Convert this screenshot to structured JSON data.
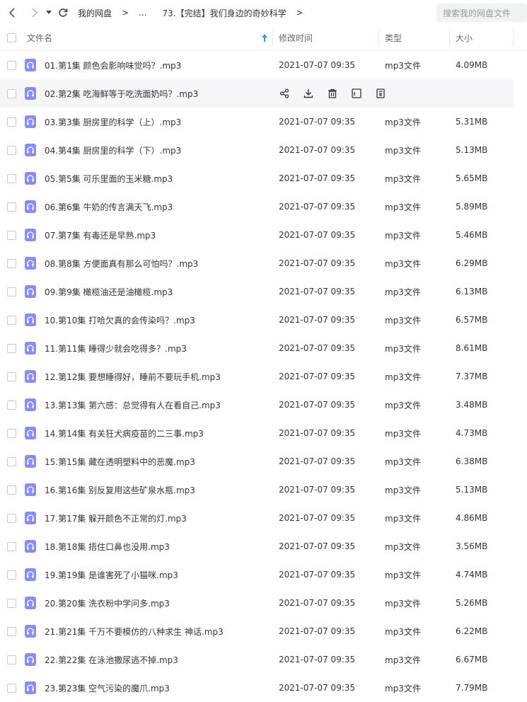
{
  "breadcrumb": {
    "root": "我的网盘",
    "sep1": ">",
    "ellipsis": "...",
    "folder": "73.【完结】我们身边的奇妙科学",
    "sep2": ">"
  },
  "search": {
    "placeholder": "搜索我的网盘文件"
  },
  "columns": {
    "name": "文件名",
    "modified": "修改时间",
    "type": "类型",
    "size": "大小"
  },
  "files": [
    {
      "name": "01.第1集 颜色会影响味觉吗？.mp3",
      "modified": "2021-07-07 09:35",
      "type": "mp3文件",
      "size": "4.09MB"
    },
    {
      "name": "02.第2集 吃海鲜等于吃洗面奶吗？.mp3",
      "modified": "",
      "type": "",
      "size": ""
    },
    {
      "name": "03.第3集 厨房里的科学（上）.mp3",
      "modified": "2021-07-07 09:35",
      "type": "mp3文件",
      "size": "5.31MB"
    },
    {
      "name": "04.第4集 厨房里的科学（下）.mp3",
      "modified": "2021-07-07 09:35",
      "type": "mp3文件",
      "size": "5.13MB"
    },
    {
      "name": "05.第5集 可乐里面的玉米糖.mp3",
      "modified": "2021-07-07 09:35",
      "type": "mp3文件",
      "size": "5.65MB"
    },
    {
      "name": "06.第6集 牛奶的传言满天飞.mp3",
      "modified": "2021-07-07 09:35",
      "type": "mp3文件",
      "size": "5.89MB"
    },
    {
      "name": "07.第7集 有毒还是早熟.mp3",
      "modified": "2021-07-07 09:35",
      "type": "mp3文件",
      "size": "5.46MB"
    },
    {
      "name": "08.第8集 方便面真有那么可怕吗？.mp3",
      "modified": "2021-07-07 09:35",
      "type": "mp3文件",
      "size": "6.29MB"
    },
    {
      "name": "09.第9集 橄榄油还是油橄榄.mp3",
      "modified": "2021-07-07 09:35",
      "type": "mp3文件",
      "size": "6.13MB"
    },
    {
      "name": "10.第10集 打哈欠真的会传染吗？.mp3",
      "modified": "2021-07-07 09:35",
      "type": "mp3文件",
      "size": "6.57MB"
    },
    {
      "name": "11.第11集 睡得少就会吃得多？.mp3",
      "modified": "2021-07-07 09:35",
      "type": "mp3文件",
      "size": "8.61MB"
    },
    {
      "name": "12.第12集 要想睡得好，睡前不要玩手机.mp3",
      "modified": "2021-07-07 09:35",
      "type": "mp3文件",
      "size": "7.37MB"
    },
    {
      "name": "13.第13集 第六感：总觉得有人在看自己.mp3",
      "modified": "2021-07-07 09:35",
      "type": "mp3文件",
      "size": "3.48MB"
    },
    {
      "name": "14.第14集 有关狂犬病疫苗的二三事.mp3",
      "modified": "2021-07-07 09:35",
      "type": "mp3文件",
      "size": "4.73MB"
    },
    {
      "name": "15.第15集 藏在透明塑料中的恶魔.mp3",
      "modified": "2021-07-07 09:35",
      "type": "mp3文件",
      "size": "6.38MB"
    },
    {
      "name": "16.第16集 别反复用这些矿泉水瓶.mp3",
      "modified": "2021-07-07 09:35",
      "type": "mp3文件",
      "size": "5.13MB"
    },
    {
      "name": "17.第17集 躲开颜色不正常的灯.mp3",
      "modified": "2021-07-07 09:35",
      "type": "mp3文件",
      "size": "4.86MB"
    },
    {
      "name": "18.第18集 捂住口鼻也没用.mp3",
      "modified": "2021-07-07 09:35",
      "type": "mp3文件",
      "size": "3.56MB"
    },
    {
      "name": "19.第19集 是谁害死了小猫咪.mp3",
      "modified": "2021-07-07 09:35",
      "type": "mp3文件",
      "size": "4.74MB"
    },
    {
      "name": "20.第20集 洗衣粉中学问多.mp3",
      "modified": "2021-07-07 09:35",
      "type": "mp3文件",
      "size": "5.26MB"
    },
    {
      "name": "21.第21集 千万不要模仿的八种求生 神话.mp3",
      "modified": "2021-07-07 09:35",
      "type": "mp3文件",
      "size": "6.22MB"
    },
    {
      "name": "22.第22集 在泳池撒尿逃不掉.mp3",
      "modified": "2021-07-07 09:35",
      "type": "mp3文件",
      "size": "6.67MB"
    },
    {
      "name": "23.第23集 空气污染的魔爪.mp3",
      "modified": "2021-07-07 09:35",
      "type": "mp3文件",
      "size": "7.79MB"
    }
  ],
  "hover_actions": [
    "share-icon",
    "download-icon",
    "delete-icon",
    "rename-icon",
    "more-icon"
  ],
  "colors": {
    "file_icon": "#8a8cf0",
    "sort_arrow": "#3b8cf7",
    "hover_row": "#f6f6f9"
  }
}
